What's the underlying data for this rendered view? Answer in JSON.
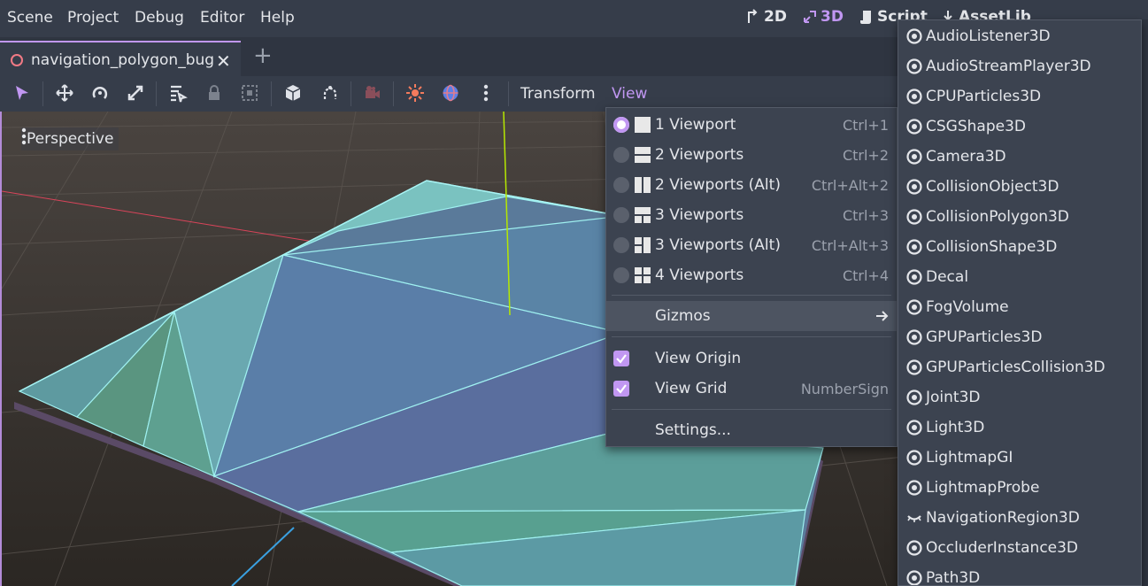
{
  "menubar": {
    "items": [
      "Scene",
      "Project",
      "Debug",
      "Editor",
      "Help"
    ],
    "workspaces": {
      "w2d": "2D",
      "w3d": "3D",
      "script": "Script",
      "assetlib": "AssetLib"
    }
  },
  "tab": {
    "title": "navigation_polygon_bug",
    "close": "✕",
    "add": "+"
  },
  "toolbar": {
    "transform_label": "Transform",
    "view_label": "View"
  },
  "viewport": {
    "perspective_label": "Perspective"
  },
  "view_menu": {
    "layouts": [
      {
        "label": "1 Viewport",
        "shortcut": "Ctrl+1",
        "selected": true
      },
      {
        "label": "2 Viewports",
        "shortcut": "Ctrl+2",
        "selected": false
      },
      {
        "label": "2 Viewports (Alt)",
        "shortcut": "Ctrl+Alt+2",
        "selected": false
      },
      {
        "label": "3 Viewports",
        "shortcut": "Ctrl+3",
        "selected": false
      },
      {
        "label": "3 Viewports (Alt)",
        "shortcut": "Ctrl+Alt+3",
        "selected": false
      },
      {
        "label": "4 Viewports",
        "shortcut": "Ctrl+4",
        "selected": false
      }
    ],
    "gizmos_label": "Gizmos",
    "view_origin_label": "View Origin",
    "view_grid_label": "View Grid",
    "view_grid_shortcut": "NumberSign",
    "settings_label": "Settings..."
  },
  "gizmos_menu": {
    "items": [
      {
        "label": "AudioListener3D",
        "icon": "eye-icon"
      },
      {
        "label": "AudioStreamPlayer3D",
        "icon": "eye-icon"
      },
      {
        "label": "CPUParticles3D",
        "icon": "eye-icon"
      },
      {
        "label": "CSGShape3D",
        "icon": "eye-icon"
      },
      {
        "label": "Camera3D",
        "icon": "eye-icon"
      },
      {
        "label": "CollisionObject3D",
        "icon": "eye-icon"
      },
      {
        "label": "CollisionPolygon3D",
        "icon": "eye-icon"
      },
      {
        "label": "CollisionShape3D",
        "icon": "eye-icon"
      },
      {
        "label": "Decal",
        "icon": "eye-icon"
      },
      {
        "label": "FogVolume",
        "icon": "eye-icon"
      },
      {
        "label": "GPUParticles3D",
        "icon": "eye-icon"
      },
      {
        "label": "GPUParticlesCollision3D",
        "icon": "eye-icon"
      },
      {
        "label": "Joint3D",
        "icon": "eye-icon"
      },
      {
        "label": "Light3D",
        "icon": "eye-icon"
      },
      {
        "label": "LightmapGI",
        "icon": "eye-icon"
      },
      {
        "label": "LightmapProbe",
        "icon": "eye-icon"
      },
      {
        "label": "NavigationRegion3D",
        "icon": "eye-closed-icon"
      },
      {
        "label": "OccluderInstance3D",
        "icon": "eye-icon"
      },
      {
        "label": "Path3D",
        "icon": "eye-icon"
      }
    ]
  },
  "colors": {
    "accent": "#c197f2",
    "panel": "#363d4a",
    "menu": "#3c4350"
  }
}
